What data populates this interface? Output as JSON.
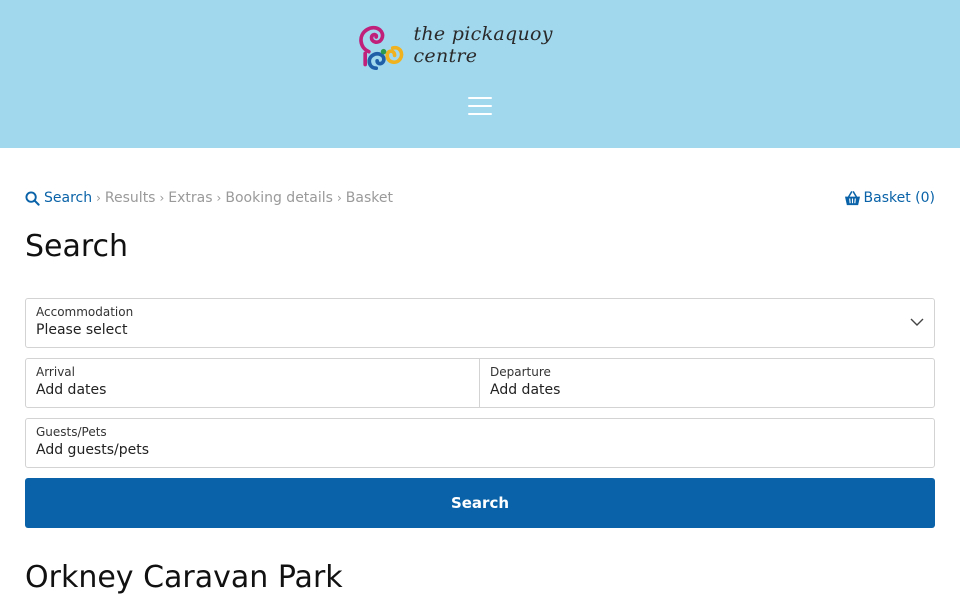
{
  "header": {
    "logo_text": "the pickaquoy centre",
    "menu_icon": "hamburger-menu-icon",
    "background_color": "#a1d8ee"
  },
  "breadcrumb": {
    "items": [
      "Search",
      "Results",
      "Extras",
      "Booking details",
      "Basket"
    ],
    "separator": "›",
    "active_icon": "search-icon"
  },
  "basket": {
    "label": "Basket (0)",
    "icon": "basket-icon"
  },
  "page": {
    "title": "Search"
  },
  "form": {
    "accommodation": {
      "label": "Accommodation",
      "value": "Please select",
      "icon": "chevron-down-icon"
    },
    "arrival": {
      "label": "Arrival",
      "value": "Add dates"
    },
    "departure": {
      "label": "Departure",
      "value": "Add dates"
    },
    "guests": {
      "label": "Guests/Pets",
      "value": "Add guests/pets"
    },
    "submit_label": "Search"
  },
  "park": {
    "title": "Orkney Caravan Park"
  },
  "colors": {
    "accent": "#0a63a8",
    "muted_text": "#9a9a9a",
    "border": "#d3d3d3"
  }
}
